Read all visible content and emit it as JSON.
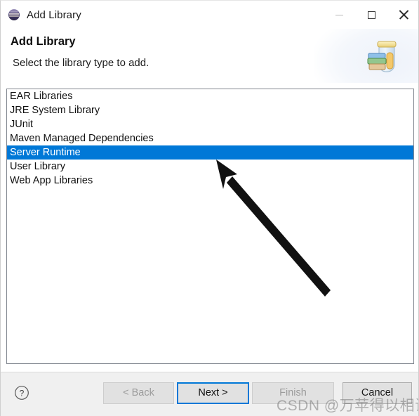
{
  "window": {
    "title": "Add Library",
    "app_icon": "eclipse-sphere-icon",
    "controls": {
      "minimize": "Minimize",
      "maximize": "Maximize",
      "close": "Close"
    }
  },
  "header": {
    "title": "Add Library",
    "subtitle": "Select the library type to add.",
    "image": "library-jar-books-icon"
  },
  "list": {
    "selected_index": 4,
    "items": [
      {
        "label": "EAR Libraries"
      },
      {
        "label": "JRE System Library"
      },
      {
        "label": "JUnit"
      },
      {
        "label": "Maven Managed Dependencies"
      },
      {
        "label": "Server Runtime"
      },
      {
        "label": "User Library"
      },
      {
        "label": "Web App Libraries"
      }
    ]
  },
  "buttons": {
    "help": "?",
    "back": "< Back",
    "next": "Next >",
    "finish": "Finish",
    "cancel": "Cancel"
  },
  "annotation": {
    "arrow": "pointer-arrow-annotation"
  },
  "watermark": {
    "text": "CSDN @万苹得以相识"
  },
  "colors": {
    "selection_blue": "#0078d7",
    "focus_border_blue": "#0078d7",
    "button_face": "#e1e1e1",
    "bar_background": "#f0f0f0",
    "list_border": "#828790",
    "disabled_text": "#9b9b9b"
  }
}
